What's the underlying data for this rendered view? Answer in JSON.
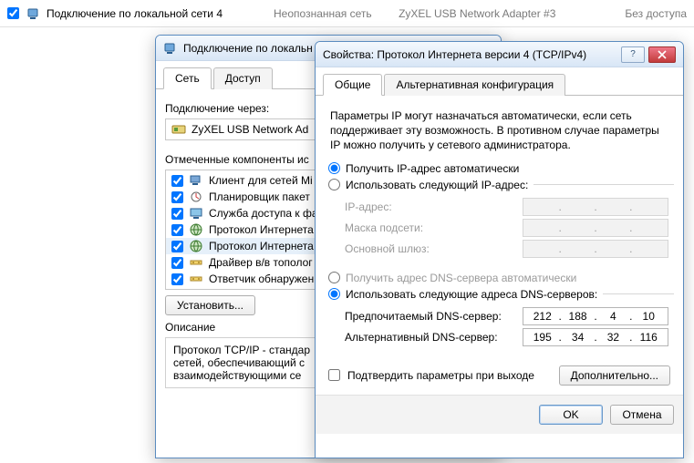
{
  "strip": {
    "checked": true,
    "name": "Подключение по локальной сети 4",
    "status1": "Неопознанная сеть",
    "adapter": "ZyXEL USB Network Adapter #3",
    "status2": "Без доступа"
  },
  "conn_window": {
    "title": "Подключение по локальн",
    "tabs": {
      "network": "Сеть",
      "access": "Доступ"
    },
    "connect_via_label": "Подключение через:",
    "adapter_name": "ZyXEL USB Network Ad",
    "components_label": "Отмеченные компоненты ис",
    "components": [
      {
        "checked": true,
        "label": "Клиент для сетей Mi",
        "icon": "client"
      },
      {
        "checked": true,
        "label": "Планировщик пакет",
        "icon": "scheduler"
      },
      {
        "checked": true,
        "label": "Служба доступа к фа",
        "icon": "share"
      },
      {
        "checked": true,
        "label": "Протокол Интернета",
        "icon": "proto"
      },
      {
        "checked": true,
        "label": "Протокол Интернета",
        "icon": "proto",
        "selected": true
      },
      {
        "checked": true,
        "label": "Драйвер в/в тополог",
        "icon": "topo"
      },
      {
        "checked": true,
        "label": "Ответчик обнаружен",
        "icon": "topo"
      }
    ],
    "buttons": {
      "install": "Установить..."
    },
    "description_label": "Описание",
    "description_text": "Протокол TCP/IP - стандар\nсетей, обеспечивающий с\nвзаимодействующими се"
  },
  "props_window": {
    "title": "Свойства: Протокол Интернета версии 4 (TCP/IPv4)",
    "tabs": {
      "general": "Общие",
      "alt": "Альтернативная конфигурация"
    },
    "info": "Параметры IP могут назначаться автоматически, если сеть поддерживает эту возможность. В противном случае параметры IP можно получить у сетевого администратора.",
    "ip": {
      "auto": "Получить IP-адрес автоматически",
      "manual": "Использовать следующий IP-адрес:",
      "ip_label": "IP-адрес:",
      "mask_label": "Маска подсети:",
      "gateway_label": "Основной шлюз:",
      "selected": "auto"
    },
    "dns": {
      "auto": "Получить адрес DNS-сервера автоматически",
      "manual": "Использовать следующие адреса DNS-серверов:",
      "selected": "manual",
      "pref_label": "Предпочитаемый DNS-сервер:",
      "alt_label": "Альтернативный DNS-сервер:",
      "pref": [
        "212",
        "188",
        "4",
        "10"
      ],
      "alt": [
        "195",
        "34",
        "32",
        "116"
      ]
    },
    "confirm_on_exit": "Подтвердить параметры при выходе",
    "advanced": "Дополнительно...",
    "ok": "OK",
    "cancel": "Отмена"
  }
}
